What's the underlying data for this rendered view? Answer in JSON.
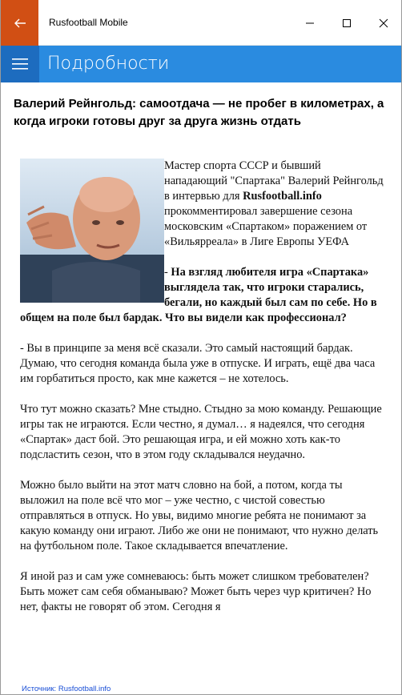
{
  "window": {
    "title": "Rusfootball Mobile"
  },
  "header": {
    "title": "Подробности"
  },
  "article": {
    "title": "Валерий Рейнгольд: самоотдача — не пробег в километрах, а когда игроки готовы друг за друга жизнь отдать",
    "lead_part1": "Мастер спорта СССР и бывший нападающий \"Спартака\" Валерий Рейнгольд в интервью для ",
    "lead_source": "Rusfootball.info",
    "lead_part2": " прокомментировал завершение сезона московским «Спартаком» поражением от «Вильярреала» в Лиге Европы УЕФА",
    "question_dash": "- ",
    "question": "На взгляд любителя игра «Спартака» выглядела так, что игроки старались, бегали, но каждый был сам по себе. Но в общем на поле был бардак. Что вы видели как профессионал?",
    "paragraphs": [
      "- Вы в принципе за меня всё сказали. Это самый настоящий бардак. Думаю, что сегодня команда была уже в отпуске. И играть, ещё два часа им горбатиться просто, как мне кажется – не хотелось.",
      "Что тут можно сказать? Мне стыдно. Стыдно за мою команду. Решающие игры так не играются. Если честно, я думал… я надеялся, что сегодня «Спартак» даст бой. Это решающая игра, и ей можно хоть как-то подсластить сезон, что в этом году складывался неудачно.",
      "Можно было выйти на этот матч словно на бой, а потом, когда ты выложил на поле всё что мог – уже честно, с чистой совестью отправляться в отпуск. Но увы, видимо многие ребята не понимают за какую команду они играют. Либо же они не понимают, что нужно делать на футбольном поле. Такое складывается впечатление.",
      "Я иной раз и сам уже сомневаюсь: быть может слишком требователен? Быть может сам себя обманываю? Может быть через чур критичен? Но нет, факты не говорят об этом. Сегодня я"
    ],
    "source": "Источник: Rusfootball.info"
  },
  "colors": {
    "back_button": "#d14f14",
    "appbar": "#2a8be0",
    "hamburger": "#1d6cbf",
    "link": "#1a4fd6"
  },
  "icons": {
    "back": "back-arrow-icon",
    "minimize": "minimize-icon",
    "maximize": "maximize-icon",
    "close": "close-icon",
    "menu": "hamburger-icon"
  }
}
